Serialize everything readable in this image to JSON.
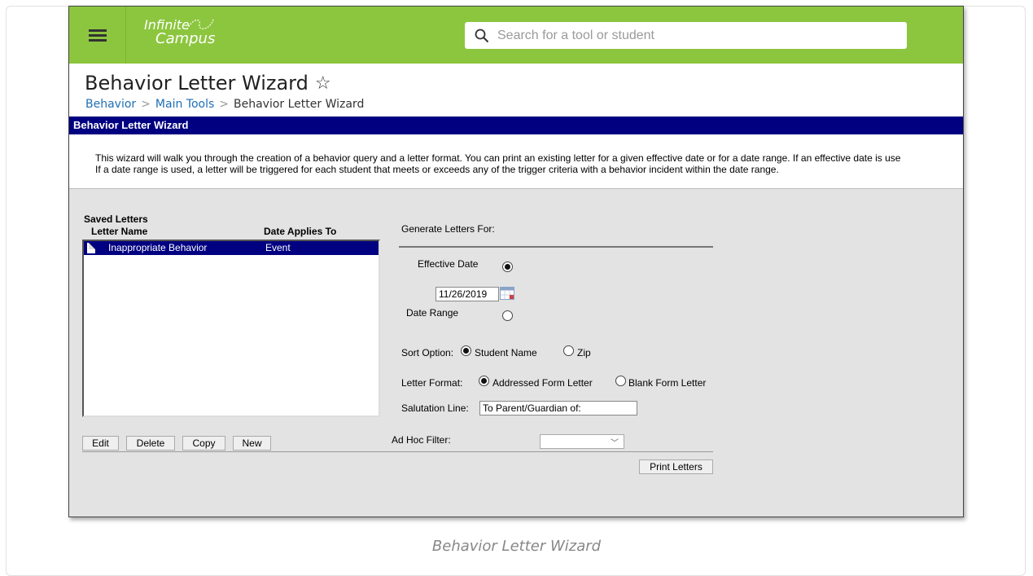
{
  "app": {
    "logo_line1": "Infinite",
    "logo_line2": "Campus",
    "search_placeholder": "Search for a tool or student"
  },
  "page": {
    "title": "Behavior Letter Wizard",
    "breadcrumb": [
      "Behavior",
      "Main Tools",
      "Behavior Letter Wizard"
    ]
  },
  "wizard": {
    "header": "Behavior Letter Wizard",
    "intro_line1": "This wizard will walk you through the creation of a behavior query and a letter format. You can print an existing letter for a given effective date or for a date range. If an effective date is use",
    "intro_line2": "If a date range is used, a letter will be triggered for each student that meets or exceeds any of the trigger criteria with a behavior incident within the date range."
  },
  "saved_letters": {
    "title": "Saved Letters",
    "columns": [
      "Letter Name",
      "Date Applies To"
    ],
    "rows": [
      {
        "name": "Inappropriate Behavior",
        "applies_to": "Event",
        "selected": true
      }
    ],
    "buttons": [
      "Edit",
      "Delete",
      "Copy",
      "New"
    ]
  },
  "generate": {
    "title": "Generate Letters For:",
    "effective_date_label": "Effective Date",
    "effective_date_selected": true,
    "effective_date_value": "11/26/2019",
    "date_range_label": "Date Range",
    "sort_option_label": "Sort Option:",
    "sort_options": [
      "Student Name",
      "Zip"
    ],
    "sort_selected": "Student Name",
    "letter_format_label": "Letter Format:",
    "letter_formats": [
      "Addressed Form Letter",
      "Blank Form Letter"
    ],
    "letter_format_selected": "Addressed Form Letter",
    "salutation_label": "Salutation Line:",
    "salutation_value": "To Parent/Guardian of:",
    "ad_hoc_label": "Ad Hoc Filter:",
    "ad_hoc_value": "",
    "print_button": "Print Letters"
  },
  "caption": "Behavior Letter Wizard",
  "colors": {
    "topbar": "#8cc63f",
    "header_bar": "#000080",
    "link": "#1f6fb5",
    "panel_bg": "#e3e3e3"
  },
  "icons": [
    "menu-icon",
    "search-icon",
    "star-icon",
    "document-icon",
    "calendar-icon",
    "chevron-down-icon"
  ]
}
